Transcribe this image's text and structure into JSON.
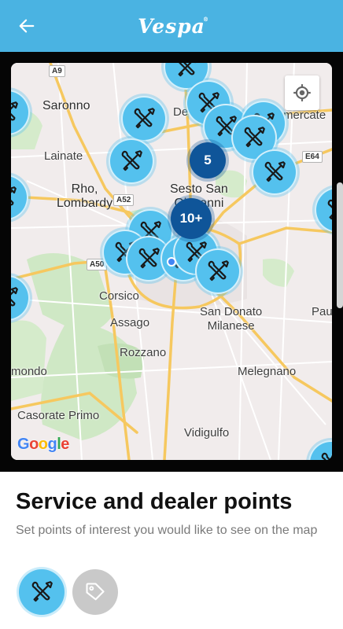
{
  "header": {
    "back_icon": "arrow-left-icon",
    "logo_text": "Vespa",
    "logo_mark": "®",
    "background": "#4ab3e2"
  },
  "map": {
    "places": {
      "saronno": "Saronno",
      "lainate": "Lainate",
      "rho": "Rho,\nLombardy",
      "sesto": "Sesto San\nGiovanni",
      "corsico": "Corsico",
      "assago": "Assago",
      "rozzano": "Rozzano",
      "san_donato": "San Donato\nMilanese",
      "melegnano": "Melegnano",
      "casorate": "Casorate Primo",
      "vidigulfo": "Vidigulfo",
      "desio": "Des",
      "vimercate": "mercate",
      "paullo": "Pau",
      "abbiategrasso": "mondo"
    },
    "roads": {
      "a9": "A9",
      "a52": "A52",
      "a50": "A50",
      "e64": "E64"
    },
    "clusters": [
      {
        "label": "5"
      },
      {
        "label": "10+"
      }
    ],
    "marker_icon": "wrench-screwdriver-icon",
    "locate_icon": "crosshair-icon",
    "attribution": "Google",
    "colors": {
      "marker": "#54c1ee",
      "cluster": "#0f5599",
      "motorway": "#f6c85f",
      "land": "#f1ecec",
      "park": "#cfe8c5"
    }
  },
  "sheet": {
    "title": "Service and dealer points",
    "subtitle": "Set points of interest you would like to see on the map",
    "filters": [
      {
        "icon": "wrench-screwdriver-icon",
        "active": true
      },
      {
        "icon": "tag-icon",
        "active": false
      }
    ]
  }
}
